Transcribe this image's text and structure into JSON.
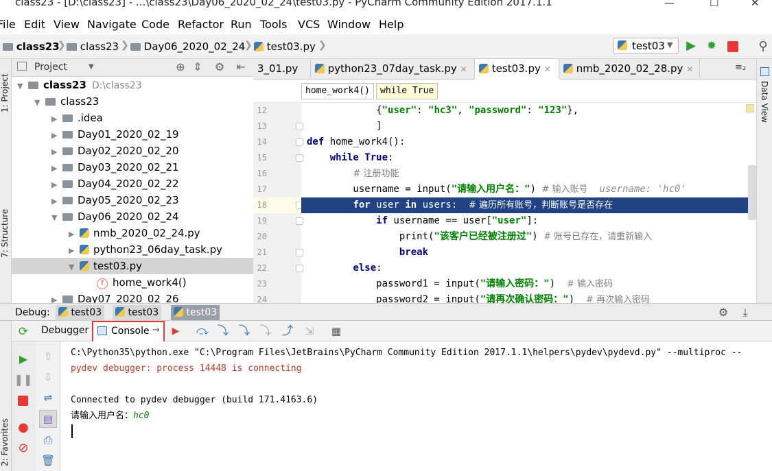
{
  "window": {
    "title": "class23 - [D:\\class23] - ...\\class23\\Day06_2020_02_24\\test03.py - PyCharm Community Edition 2017.1.1"
  },
  "menu": [
    "File",
    "Edit",
    "View",
    "Navigate",
    "Code",
    "Refactor",
    "Run",
    "Tools",
    "VCS",
    "Window",
    "Help"
  ],
  "nav": {
    "crumbs": [
      "class23",
      "class23",
      "Day06_2020_02_24",
      "test03.py"
    ],
    "run_config": "test03"
  },
  "project": {
    "header": "Project",
    "tree": [
      {
        "label": "class23",
        "suffix": "D:\\class23",
        "level": 0,
        "arrow": "▼",
        "kind": "folder",
        "bold": true
      },
      {
        "label": "class23",
        "level": 1,
        "arrow": "▼",
        "kind": "folder"
      },
      {
        "label": ".idea",
        "level": 2,
        "arrow": "▶",
        "kind": "folder"
      },
      {
        "label": "Day01_2020_02_19",
        "level": 2,
        "arrow": "▶",
        "kind": "folder"
      },
      {
        "label": "Day02_2020_02_20",
        "level": 2,
        "arrow": "▶",
        "kind": "folder"
      },
      {
        "label": "Day03_2020_02_21",
        "level": 2,
        "arrow": "▶",
        "kind": "folder"
      },
      {
        "label": "Day04_2020_02_22",
        "level": 2,
        "arrow": "▶",
        "kind": "folder"
      },
      {
        "label": "Day05_2020_02_23",
        "level": 2,
        "arrow": "▶",
        "kind": "folder"
      },
      {
        "label": "Day06_2020_02_24",
        "level": 2,
        "arrow": "▼",
        "kind": "folder"
      },
      {
        "label": "nmb_2020_02_24.py",
        "level": 3,
        "arrow": "▶",
        "kind": "py"
      },
      {
        "label": "python23_06day_task.py",
        "level": 3,
        "arrow": "▶",
        "kind": "py"
      },
      {
        "label": "test03.py",
        "level": 3,
        "arrow": "▼",
        "kind": "py",
        "selected": true
      },
      {
        "label": "home_work4()",
        "level": 4,
        "arrow": "",
        "kind": "func"
      },
      {
        "label": "Day07_2020_02_26",
        "level": 2,
        "arrow": "▶",
        "kind": "folder"
      }
    ]
  },
  "side_labels": {
    "project": "1: Project",
    "structure": "7: Structure",
    "favorites": "2: Favorites",
    "dataview": "Data View"
  },
  "tabs": [
    {
      "label": "3_01.py",
      "active": false
    },
    {
      "label": "python23_07day_task.py",
      "active": false
    },
    {
      "label": "test03.py",
      "active": true
    },
    {
      "label": "nmb_2020_02_28.py",
      "active": false
    }
  ],
  "tabs_overflow": "≡₂",
  "editor": {
    "breadcrumbs": [
      "home_work4()",
      "while True"
    ],
    "lines": [
      {
        "n": "12",
        "segs": [
          [
            "            ",
            ""
          ],
          [
            "{",
            ""
          ],
          [
            "\"user\"",
            "str"
          ],
          [
            ": ",
            ""
          ],
          [
            "\"hc3\"",
            "str"
          ],
          [
            ", ",
            ""
          ],
          [
            "\"password\"",
            "str"
          ],
          [
            ": ",
            ""
          ],
          [
            "\"123\"",
            "str"
          ],
          [
            "},",
            ""
          ]
        ]
      },
      {
        "n": "13",
        "segs": [
          [
            "            ]",
            ""
          ]
        ]
      },
      {
        "n": "14",
        "segs": [
          [
            "def ",
            "kw"
          ],
          [
            "home_work4():",
            ""
          ]
        ]
      },
      {
        "n": "15",
        "segs": [
          [
            "    ",
            ""
          ],
          [
            "while True",
            "kw"
          ],
          [
            ":",
            ""
          ]
        ]
      },
      {
        "n": "16",
        "segs": [
          [
            "        ",
            ""
          ],
          [
            "# 注册功能",
            "cmt"
          ]
        ]
      },
      {
        "n": "17",
        "segs": [
          [
            "        username = input(",
            ""
          ],
          [
            "\"请输入用户名：\"",
            "str"
          ],
          [
            ") ",
            ""
          ],
          [
            "# 输入账号",
            "cmt"
          ],
          [
            "  username: 'hc0'",
            "hint"
          ]
        ]
      },
      {
        "n": "18",
        "segs": [
          [
            "        ",
            ""
          ],
          [
            "for ",
            "kw"
          ],
          [
            "user ",
            ""
          ],
          [
            "in ",
            "kw"
          ],
          [
            "users:  ",
            ""
          ],
          [
            "# 遍历所有账号，判断账号是否存在",
            "cmt"
          ]
        ]
      },
      {
        "n": "19",
        "segs": [
          [
            "            ",
            ""
          ],
          [
            "if ",
            "kw"
          ],
          [
            "username == user[",
            ""
          ],
          [
            "\"user\"",
            "str"
          ],
          [
            "]:",
            ""
          ]
        ]
      },
      {
        "n": "20",
        "segs": [
          [
            "                print(",
            ""
          ],
          [
            "\"该客户已经被注册过\"",
            "str"
          ],
          [
            ") ",
            ""
          ],
          [
            "# 账号已存在，请重新输入",
            "cmt"
          ]
        ]
      },
      {
        "n": "21",
        "segs": [
          [
            "                ",
            ""
          ],
          [
            "break",
            "kw"
          ]
        ]
      },
      {
        "n": "22",
        "segs": [
          [
            "        ",
            ""
          ],
          [
            "else",
            "kw"
          ],
          [
            ":",
            ""
          ]
        ]
      },
      {
        "n": "23",
        "segs": [
          [
            "            password1 = input(",
            ""
          ],
          [
            "\"请输入密码：\"",
            "str"
          ],
          [
            ")  ",
            ""
          ],
          [
            "# 输入密码",
            "cmt"
          ]
        ]
      },
      {
        "n": "24",
        "segs": [
          [
            "            password2 = input(",
            ""
          ],
          [
            "\"请再次确认密码：\"",
            "str"
          ],
          [
            ")  ",
            ""
          ],
          [
            "# 再次输入密码",
            "cmt"
          ]
        ]
      }
    ],
    "highlight_line": "18"
  },
  "debug": {
    "label": "Debug:",
    "tabs": [
      "test03",
      "test03",
      "test03"
    ],
    "debugger_tab": "Debugger",
    "console_tab": "Console",
    "console_lines": [
      {
        "text": "C:\\Python35\\python.exe \"C:\\Program Files\\JetBrains\\PyCharm Community Edition 2017.1.1\\helpers\\pydev\\pydevd.py\" --multiproc --",
        "color": "#000000"
      },
      {
        "text": "pydev debugger: process 14448 is connecting",
        "color": "#c0392b"
      },
      {
        "text": "",
        "color": "#000000"
      },
      {
        "text": "Connected to pydev debugger (build 171.4163.6)",
        "color": "#000000"
      }
    ],
    "prompt": "请输入用户名：",
    "input_value": "hc0"
  },
  "colors": {
    "highlight": "#214283",
    "selected_row": "#d5d5d5",
    "accent_green": "#2ca02c",
    "stop_red": "#e53935"
  }
}
